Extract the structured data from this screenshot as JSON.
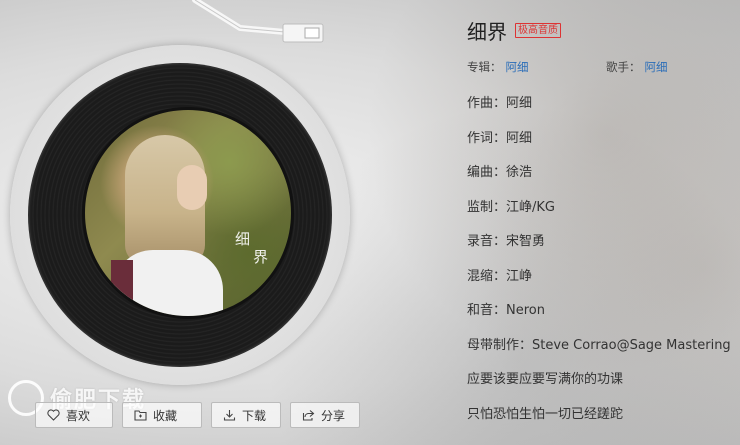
{
  "song": {
    "title": "细界",
    "quality_badge": "极高音质",
    "album_label": "专辑：",
    "album_name": "阿细",
    "singer_label": "歌手：",
    "singer_name": "阿细"
  },
  "credits": [
    "作曲：阿细",
    "作词：阿细",
    "编曲：徐浩",
    "监制：江峥/KG",
    "录音：宋智勇",
    "混缩：江峥",
    "和音：Neron",
    "母带制作：Steve Corrao@Sage Mastering",
    "应要该要应要写满你的功课",
    "只怕恐怕生怕一切已经蹉跎"
  ],
  "cover": {
    "line1": "细",
    "line2": "界"
  },
  "actions": {
    "like": "喜欢",
    "collect": "收藏",
    "download": "下载",
    "share": "分享"
  },
  "watermark": "偷肥下载",
  "colors": {
    "link": "#2a6db8",
    "badge": "#d33333"
  },
  "icons": {
    "like": "heart-icon",
    "collect": "folder-icon",
    "download": "download-icon",
    "share": "share-icon"
  }
}
